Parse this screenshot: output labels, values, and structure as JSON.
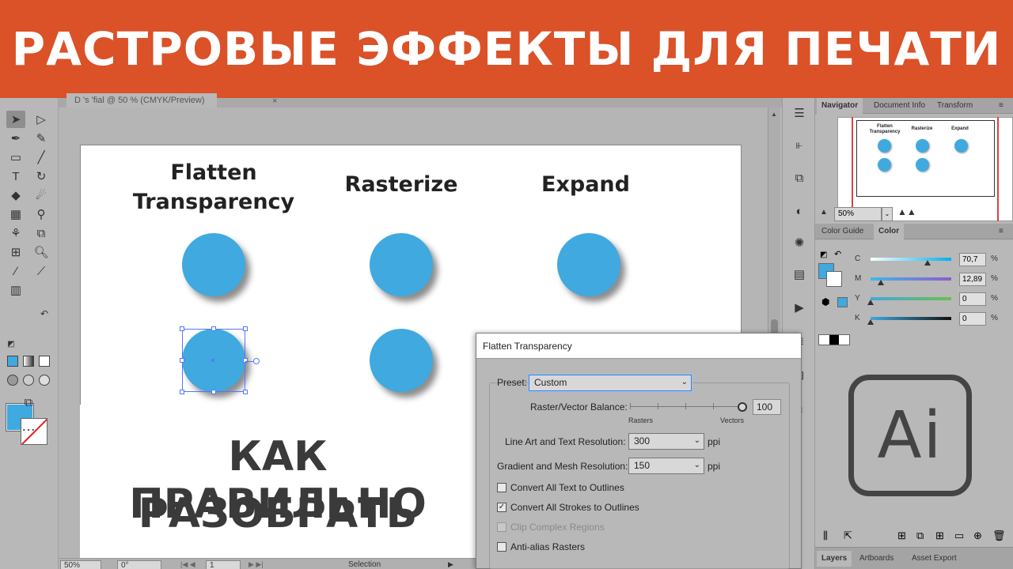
{
  "banner": {
    "title": "РАСТРОВЫЕ ЭФФЕКТЫ ДЛЯ ПЕЧАТИ"
  },
  "document": {
    "tab_label": "D 's 'fial @ 50 % (CMYK/Preview)",
    "tab_close": "×"
  },
  "artboard": {
    "columns": [
      {
        "label": "Flatten Transparency"
      },
      {
        "label": "Rasterize"
      },
      {
        "label": "Expand"
      }
    ],
    "overlay_text": [
      "КАК ПРАВИЛЬНО",
      "РАЗОБРАТЬ"
    ]
  },
  "statusbar": {
    "zoom": "50%",
    "rotation": "0°",
    "artboard_number": "1",
    "tool": "Selection"
  },
  "colors": {
    "banner": "#db5128",
    "circle": "#3fa9e0",
    "selection": "#5577ff"
  },
  "navigator": {
    "tabs": [
      "Navigator",
      "Document Info",
      "Transform"
    ],
    "active_tab": "Navigator",
    "zoom": "50%",
    "thumb_labels": [
      "Flatten Transparency",
      "Rasterize",
      "Expand"
    ]
  },
  "color_panel": {
    "tabs": [
      "Color Guide",
      "Color"
    ],
    "active_tab": "Color",
    "channels": [
      {
        "label": "C",
        "value": "70,7",
        "unit": "%",
        "level": 0.707
      },
      {
        "label": "M",
        "value": "12,89",
        "unit": "%",
        "level": 0.1289
      },
      {
        "label": "Y",
        "value": "0",
        "unit": "%",
        "level": 0
      },
      {
        "label": "K",
        "value": "0",
        "unit": "%",
        "level": 0
      }
    ]
  },
  "ai_logo": {
    "text": "Ai"
  },
  "layers_panel": {
    "tabs": [
      "Layers",
      "Artboards",
      "Asset Export"
    ],
    "active_tab": "Layers"
  },
  "dialog": {
    "title": "Flatten Transparency",
    "preset_label": "Preset:",
    "preset_value": "Custom",
    "balance_label": "Raster/Vector Balance:",
    "balance_value": "100",
    "balance_min_label": "Rasters",
    "balance_max_label": "Vectors",
    "line_art_label": "Line Art and Text Resolution:",
    "line_art_value": "300",
    "gradient_label": "Gradient and Mesh Resolution:",
    "gradient_value": "150",
    "unit": "ppi",
    "checkboxes": [
      {
        "label": "Convert All Text to Outlines",
        "checked": false,
        "disabled": false
      },
      {
        "label": "Convert All Strokes to Outlines",
        "checked": true,
        "disabled": false
      },
      {
        "label": "Clip Complex Regions",
        "checked": false,
        "disabled": true
      },
      {
        "label": "Anti-alias Rasters",
        "checked": false,
        "disabled": false
      }
    ]
  }
}
